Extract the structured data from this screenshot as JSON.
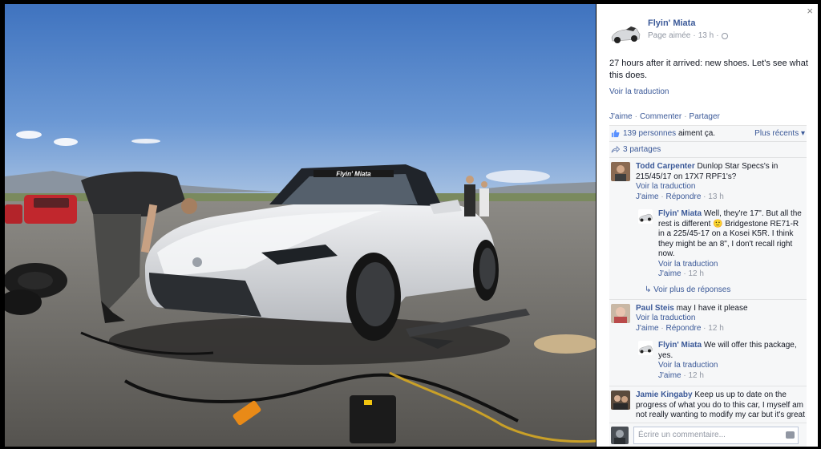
{
  "post": {
    "page_name": "Flyin' Miata",
    "meta_status": "Page aimée",
    "meta_time": "13 h",
    "text": "27 hours after it arrived: new shoes. Let's see what this does.",
    "translate_label": "Voir la traduction",
    "actions": [
      "J'aime",
      "Commenter",
      "Partager"
    ]
  },
  "ufi": {
    "likes_count": "139 personnes",
    "likes_suffix": "aiment ça.",
    "sort_label": "Plus récents ▾",
    "shares": "3 partages"
  },
  "comments": [
    {
      "author": "Todd Carpenter",
      "text": "Dunlop Star Specs's in 215/45/17 on 17X7 RPF1's?",
      "translate": "Voir la traduction",
      "like": "J'aime",
      "reply": "Répondre",
      "time": "13 h"
    },
    {
      "author": "Flyin' Miata",
      "text": "Well, they're 17\". But all the rest is different 🙂 Bridgestone RE71-R in a 225/45-17 on a Kosei K5R. I think they might be an 8\", I don't recall right now.",
      "translate": "Voir la traduction",
      "like": "J'aime",
      "time": "12 h"
    },
    {
      "more": "Voir plus de réponses"
    },
    {
      "author": "Paul Steis",
      "text": "may I have it please",
      "translate": "Voir la traduction",
      "like": "J'aime",
      "reply": "Répondre",
      "time": "12 h"
    },
    {
      "author": "Flyin' Miata",
      "text": "We will offer this package, yes.",
      "translate": "Voir la traduction",
      "like": "J'aime",
      "time": "12 h"
    },
    {
      "author": "Jamie Kingaby",
      "text": "Keep us up to date on the progress of what you do to this car, I myself am not really wanting to modify my car but it's great"
    }
  ],
  "comment_box": {
    "placeholder": "Écrire un commentaire..."
  },
  "photo": {
    "windshield_banner": "Flyin' Miata"
  },
  "close_label": "×"
}
